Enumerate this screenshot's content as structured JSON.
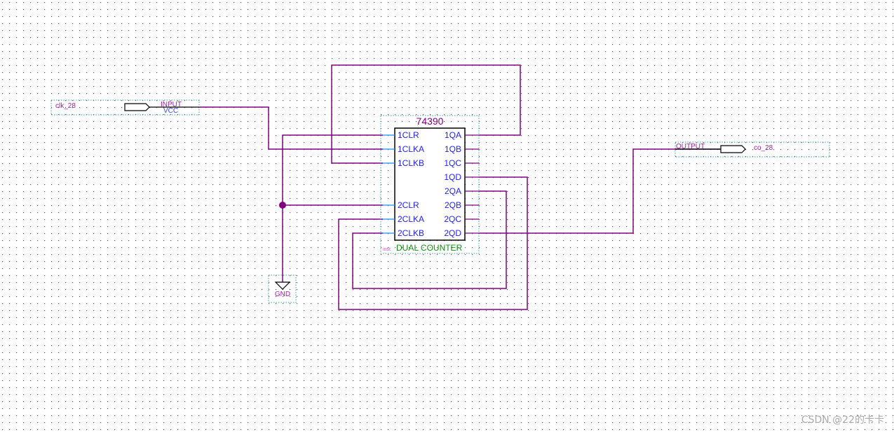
{
  "colors": {
    "wire": "#800080",
    "pin_line": "#1e90ff",
    "pin_text": "#2020ff",
    "component_name": "#800080",
    "component_desc": "#109010",
    "grid": "#555555"
  },
  "input_pin": {
    "name": "clk_28",
    "type": "INPUT",
    "default": "VCC"
  },
  "output_pin": {
    "name": "co_28",
    "type": "OUTPUT"
  },
  "ground": {
    "label": "GND"
  },
  "component": {
    "name": "74390",
    "instance": "inst",
    "description": "DUAL COUNTER",
    "inputs": [
      "1CLR",
      "1CLKA",
      "1CLKB",
      "2CLR",
      "2CLKA",
      "2CLKB"
    ],
    "outputs": [
      "1QA",
      "1QB",
      "1QC",
      "1QD",
      "2QA",
      "2QB",
      "2QC",
      "2QD"
    ]
  },
  "watermark": "CSDN @22的卡卡"
}
